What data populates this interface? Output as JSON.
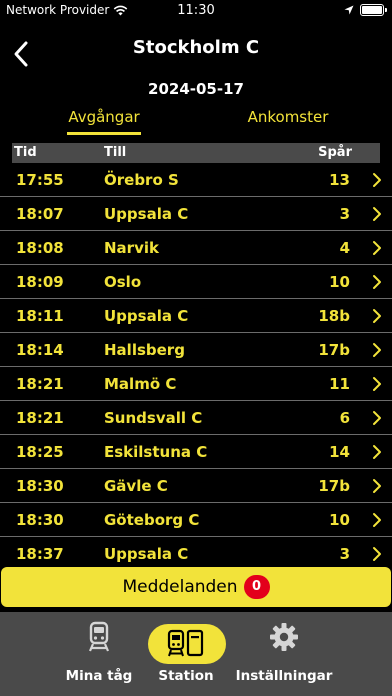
{
  "status_bar": {
    "carrier": "Network Provider",
    "time": "11:30",
    "icons": [
      "wifi-icon",
      "location-arrow-icon",
      "battery-icon"
    ]
  },
  "header": {
    "title": "Stockholm C",
    "back_icon": "chevron-left-icon"
  },
  "date": "2024-05-17",
  "tabs": [
    {
      "label": "Avgångar",
      "selected": true
    },
    {
      "label": "Ankomster",
      "selected": false
    }
  ],
  "table": {
    "columns": {
      "time": "Tid",
      "to": "Till",
      "track": "Spår"
    },
    "rows": [
      {
        "time": "17:55",
        "destination": "Örebro S",
        "track": "13"
      },
      {
        "time": "18:07",
        "destination": "Uppsala C",
        "track": "3"
      },
      {
        "time": "18:08",
        "destination": "Narvik",
        "track": "4"
      },
      {
        "time": "18:09",
        "destination": "Oslo",
        "track": "10"
      },
      {
        "time": "18:11",
        "destination": "Uppsala C",
        "track": "18b"
      },
      {
        "time": "18:14",
        "destination": "Hallsberg",
        "track": "17b"
      },
      {
        "time": "18:21",
        "destination": "Malmö C",
        "track": "11"
      },
      {
        "time": "18:21",
        "destination": "Sundsvall C",
        "track": "6"
      },
      {
        "time": "18:25",
        "destination": "Eskilstuna C",
        "track": "14"
      },
      {
        "time": "18:30",
        "destination": "Gävle C",
        "track": "17b"
      },
      {
        "time": "18:30",
        "destination": "Göteborg C",
        "track": "10"
      },
      {
        "time": "18:37",
        "destination": "Uppsala C",
        "track": "3"
      }
    ]
  },
  "messages": {
    "label": "Meddelanden",
    "count": "0"
  },
  "tab_bar": {
    "items": [
      {
        "label": "Mina tåg",
        "icon": "train-icon",
        "selected": false
      },
      {
        "label": "Station",
        "icon": "station-icon",
        "selected": true
      },
      {
        "label": "Inställningar",
        "icon": "gear-icon",
        "selected": false
      }
    ]
  },
  "colors": {
    "accent": "#f2e33a",
    "background": "#000000",
    "header_bar": "#4a4a4a",
    "badge": "#e3001b"
  }
}
